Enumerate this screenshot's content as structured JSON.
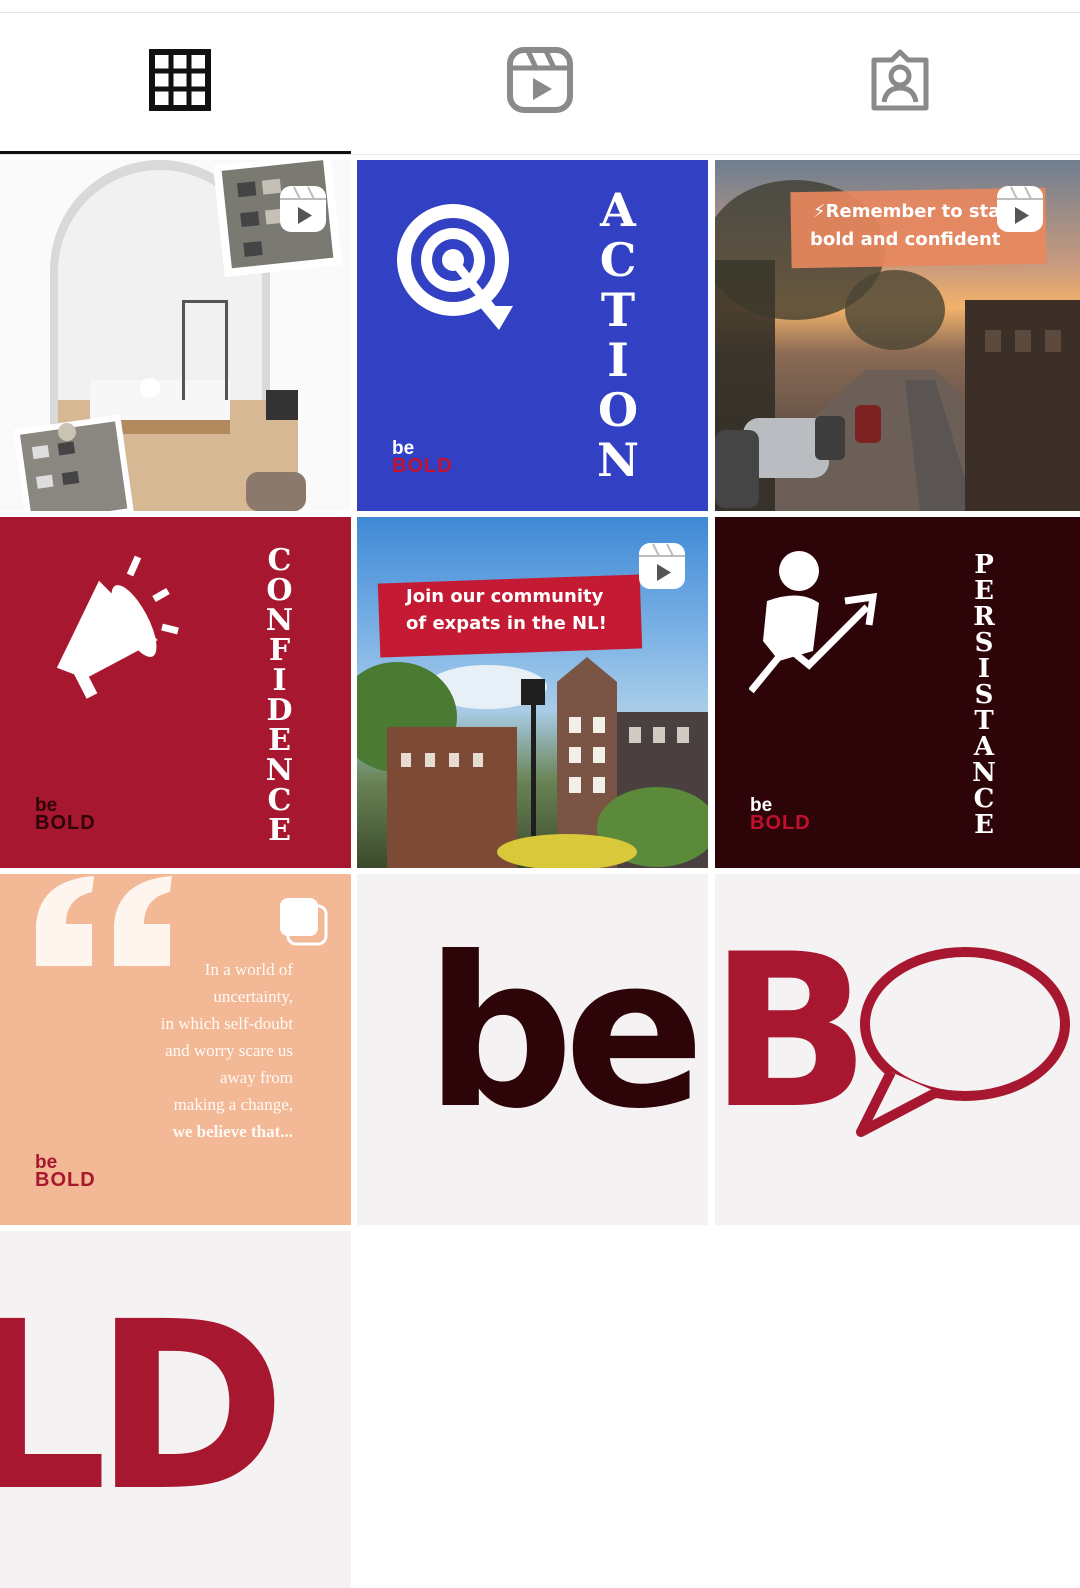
{
  "tabs": [
    {
      "name": "posts",
      "icon": "grid-icon",
      "active": true
    },
    {
      "name": "reels",
      "icon": "reels-icon",
      "active": false
    },
    {
      "name": "tagged",
      "icon": "tagged-person-icon",
      "active": false
    }
  ],
  "colors": {
    "brand_red": "#a71730",
    "brand_dark": "#2d0407",
    "action_blue": "#3240c3",
    "peach": "#f3b896"
  },
  "posts": {
    "p1": {
      "type": "reel"
    },
    "p2": {
      "word": "ACTION",
      "brand_be": "be",
      "brand_bold": "BOLD"
    },
    "p3": {
      "type": "reel",
      "line1": "⚡Remember to stay",
      "line2": "bold and confident"
    },
    "p4": {
      "word": "CONFIDENCE",
      "brand_be": "be",
      "brand_bold": "BOLD"
    },
    "p5": {
      "type": "reel",
      "line1": "Join our community",
      "line2": "of expats in the NL!"
    },
    "p6": {
      "word": "PERSISTANCE",
      "brand_be": "be",
      "brand_bold": "BOLD"
    },
    "p7": {
      "type": "carousel",
      "quote_lines": [
        "In a world of",
        "uncertainty,",
        "in which self-doubt",
        "and worry scare us",
        "away from",
        "making a change,"
      ],
      "quote_last": "we believe that...",
      "brand_be": "be",
      "brand_bold": "BOLD"
    },
    "p8": {
      "text": "be"
    },
    "p9": {
      "text": "B"
    },
    "p10": {
      "text": "LD"
    }
  }
}
